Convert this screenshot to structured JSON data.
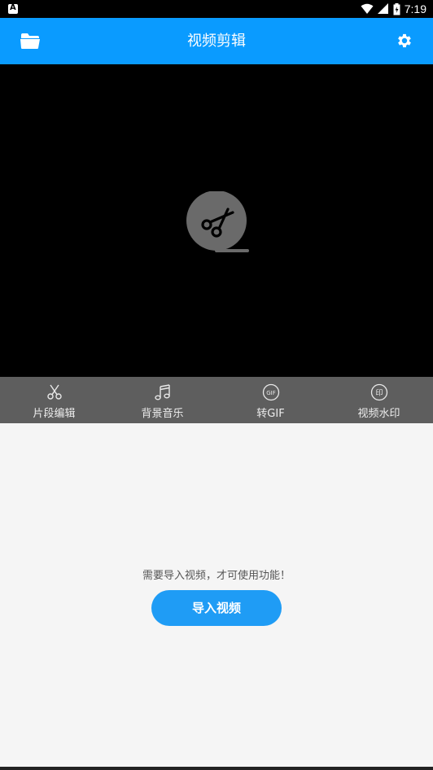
{
  "status_bar": {
    "time": "7:19",
    "icons": [
      "app-notification-icon",
      "wifi-icon",
      "signal-icon",
      "battery-icon"
    ]
  },
  "app_bar": {
    "title": "视频剪辑",
    "left_icon": "folder-icon",
    "right_icon": "gear-icon",
    "color": "#0a9bff"
  },
  "video_area": {
    "placeholder_icon": "scissors-film-icon"
  },
  "tools": [
    {
      "label": "片段编辑",
      "icon": "scissors-icon"
    },
    {
      "label": "背景音乐",
      "icon": "music-note-icon"
    },
    {
      "label": "转GIF",
      "icon": "gif-icon",
      "icon_text": "GIF"
    },
    {
      "label": "视频水印",
      "icon": "watermark-icon",
      "icon_text": "印"
    }
  ],
  "content": {
    "hint": "需要导入视频，才可使用功能！",
    "import_button": "导入视频",
    "button_color": "#1f9cf5"
  }
}
